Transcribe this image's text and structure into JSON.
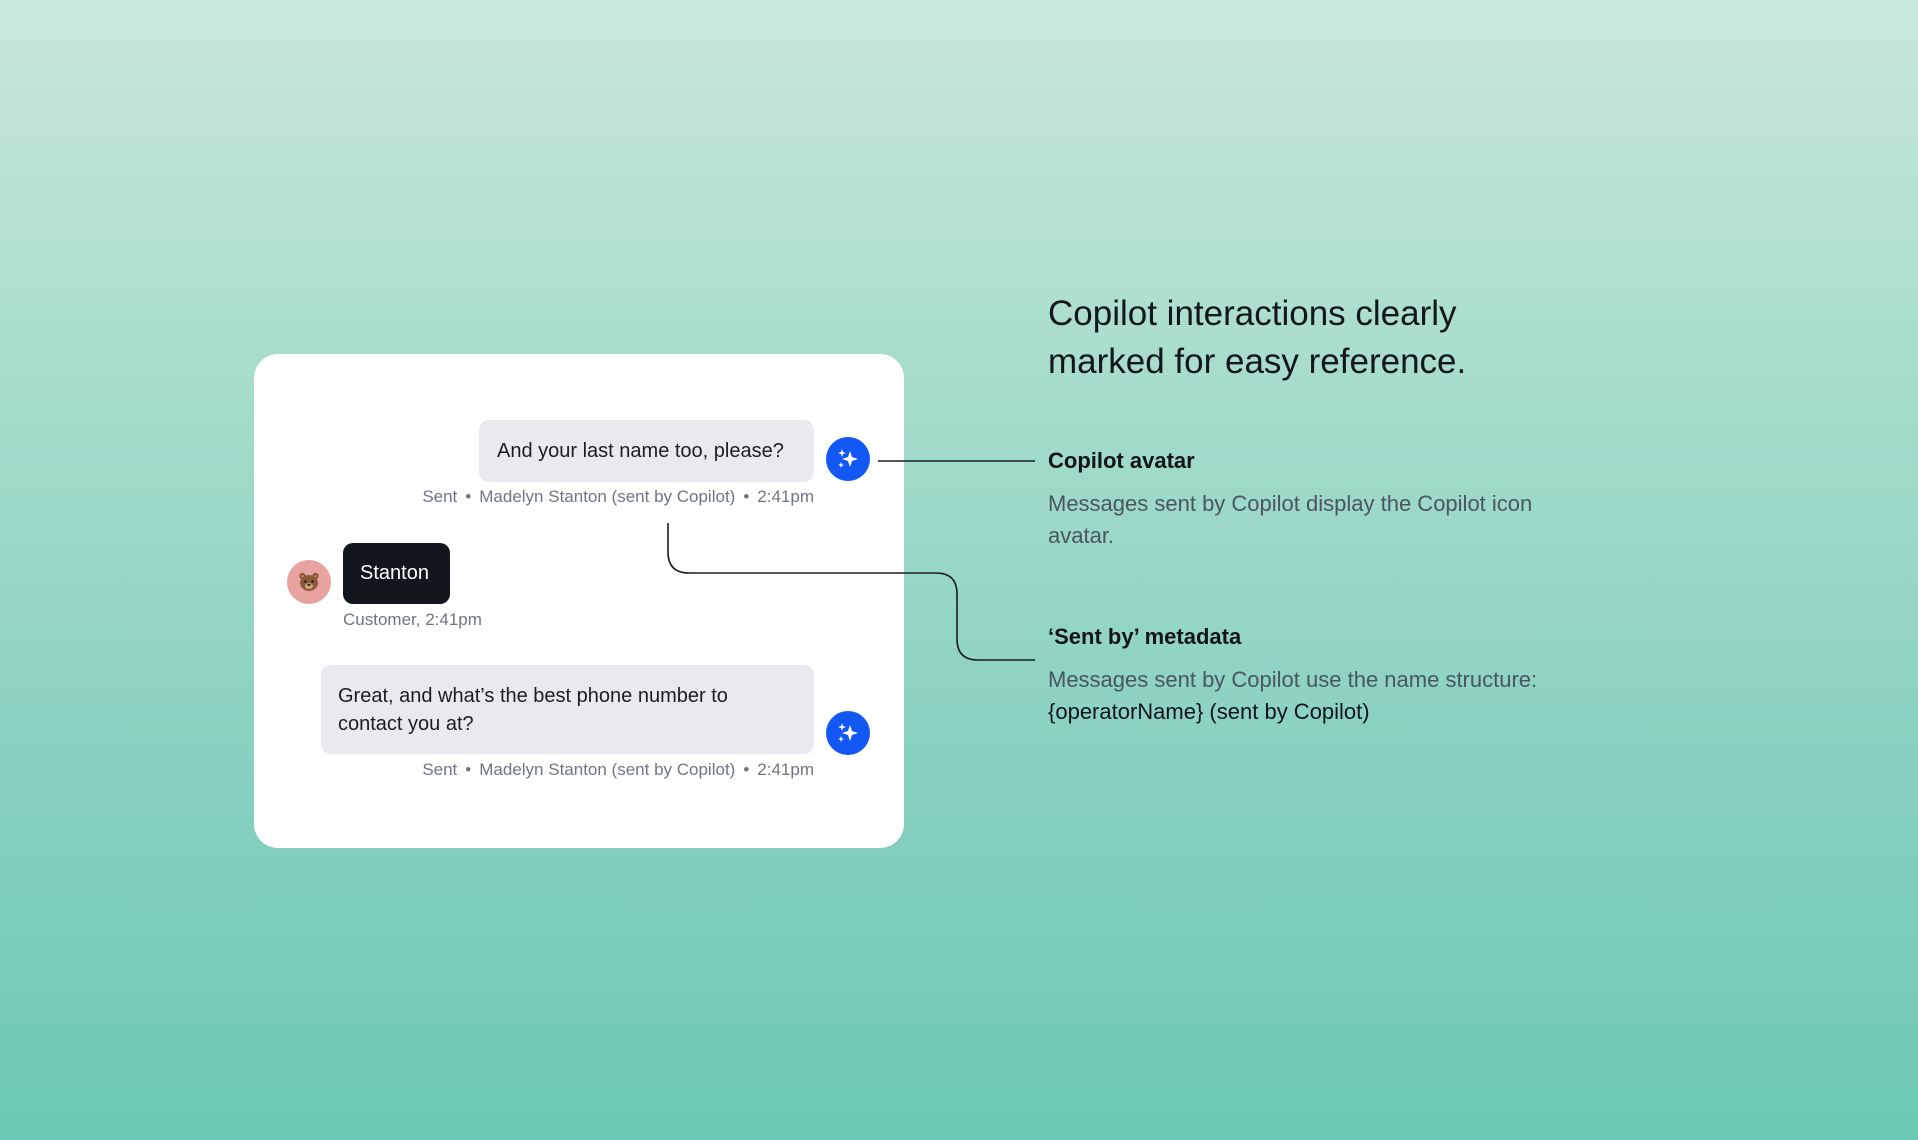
{
  "chat": {
    "messages": [
      {
        "text": "And your last name too, please?",
        "status": "Sent",
        "sender": "Madelyn Stanton (sent by Copilot)",
        "time": "2:41pm"
      },
      {
        "text": "Stanton",
        "meta": "Customer, 2:41pm"
      },
      {
        "text": "Great, and what’s the best phone number to contact you at?",
        "status": "Sent",
        "sender": "Madelyn Stanton (sent by Copilot)",
        "time": "2:41pm"
      }
    ]
  },
  "annotations": {
    "headline": "Copilot interactions clearly marked for easy reference.",
    "items": [
      {
        "title": "Copilot avatar",
        "description": "Messages sent by Copilot display the Copilot icon avatar."
      },
      {
        "title": "‘Sent by’ metadata",
        "description": "Messages sent by Copilot use the name structure:",
        "code": "{operatorName} (sent by Copilot)"
      }
    ]
  },
  "colors": {
    "copilot_blue": "#1358f5",
    "customer_avatar": "#e8a3a1",
    "operator_bubble": "#e9eaee",
    "customer_bubble": "#13161c"
  },
  "icons": {
    "copilot": "sparkles-icon",
    "customer": "bear-icon"
  }
}
